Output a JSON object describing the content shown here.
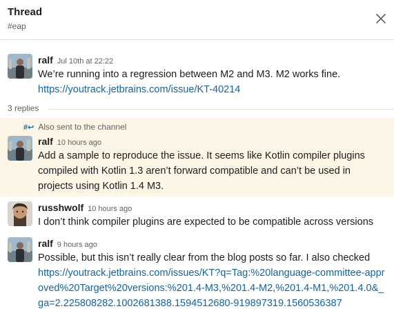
{
  "header": {
    "title": "Thread",
    "channel": "#eap"
  },
  "messages": [
    {
      "author": "ralf",
      "time": "Jul 10th at 22:22",
      "text": "We’re running into a regression between M2 and M3. M2 works fine.",
      "link": "https://youtrack.jetbrains.com/issue/KT-40214"
    },
    {
      "author": "ralf",
      "time": "10 hours ago",
      "text": "Add a sample to reproduce the issue. It seems like Kotlin compiler plugins compiled with Kotlin 1.3 aren’t forward compatible and can’t be used in projects using Kotlin 1.4 M3."
    },
    {
      "author": "russhwolf",
      "time": "10 hours ago",
      "text": "I don’t think compiler plugins are expected to be compatible across versions"
    },
    {
      "author": "ralf",
      "time": "9 hours ago",
      "text": "Possible, but this isn’t really clear from the blog posts so far. I also checked",
      "link": "https://youtrack.jetbrains.com/issues/KT?q=Tag:%20language-committee-approved%20Target%20versions:%201.4-M3,%201.4-M2,%201.4-M1,%201.4.0&_ga=2.225808282.1002681388.1594512680-919897319.1560536387"
    }
  ],
  "thread": {
    "replies_label": "3 replies",
    "sent_to_channel": "Also sent to the channel"
  },
  "icons": {
    "close": "close-icon",
    "sent": "channel-share-icon"
  },
  "colors": {
    "link": "#1264a3",
    "highlight_bg": "#fdf5e5",
    "muted_text": "#616061"
  }
}
